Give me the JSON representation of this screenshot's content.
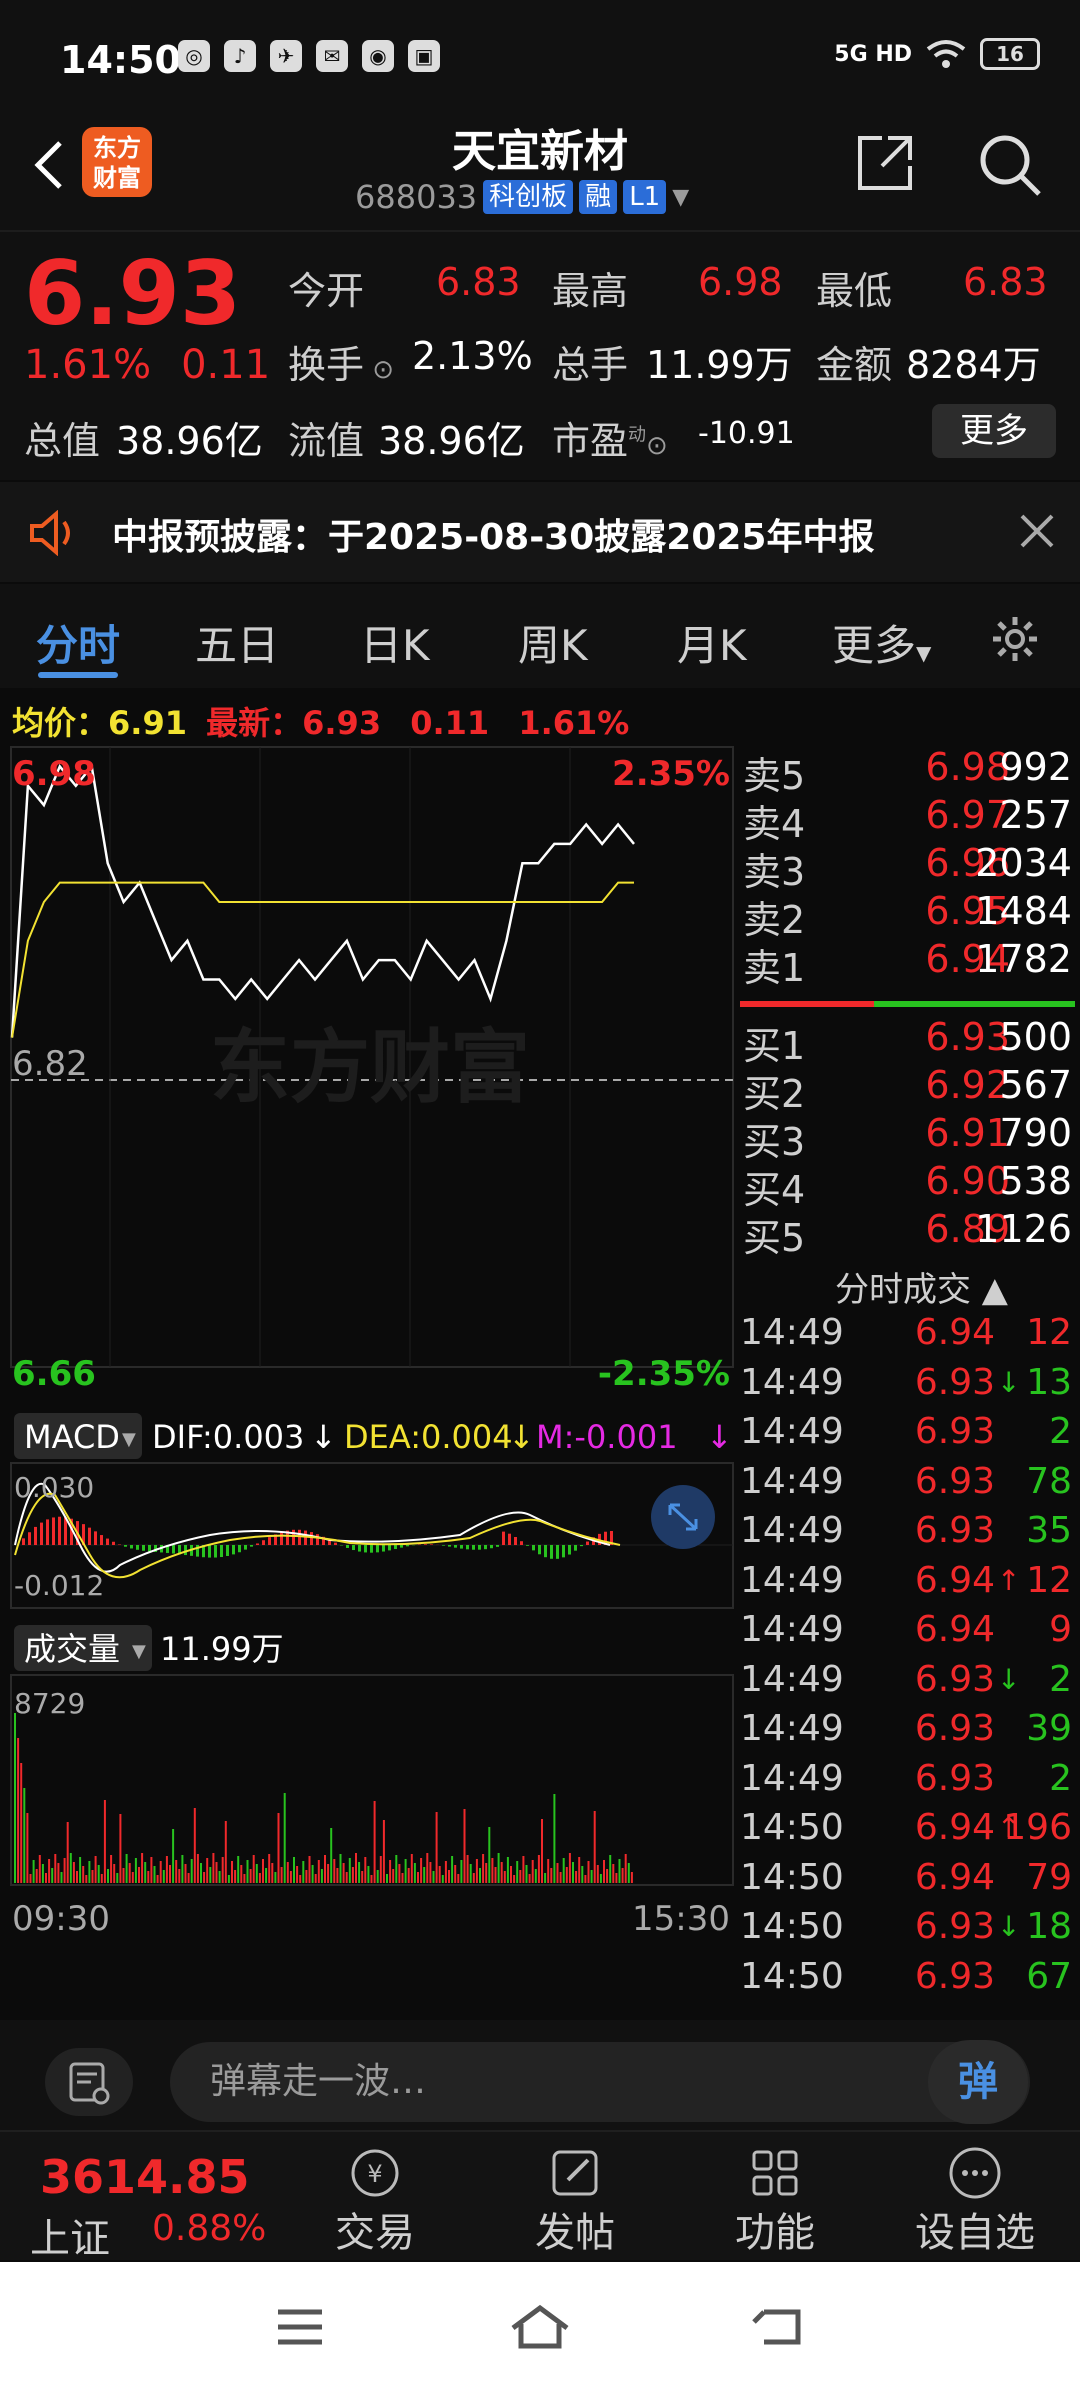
{
  "status": {
    "time": "14:50",
    "network": "5G HD",
    "battery": "16"
  },
  "header": {
    "title": "天宜新材",
    "code": "688033",
    "tags": [
      "科创板",
      "融",
      "L1"
    ],
    "logo_text": "东方\n财富"
  },
  "quote": {
    "price": "6.93",
    "change_pct": "1.61%",
    "change": "0.11",
    "open_label": "今开",
    "open": "6.83",
    "high_label": "最高",
    "high": "6.98",
    "low_label": "最低",
    "low": "6.83",
    "turnover_label": "换手",
    "turnover": "2.13%",
    "volume_label": "总手",
    "volume": "11.99万",
    "amount_label": "金额",
    "amount": "8284万",
    "mktcap_label": "总值",
    "mktcap": "38.96亿",
    "float_label": "流值",
    "float": "38.96亿",
    "pe_label": "市盈",
    "pe_sup": "动",
    "pe": "-10.91",
    "more_label": "更多"
  },
  "notice": {
    "text": "中报预披露：于2025-08-30披露2025年中报"
  },
  "tabs": {
    "items": [
      "分时",
      "五日",
      "日K",
      "周K",
      "月K",
      "更多"
    ],
    "active": 0
  },
  "avgbar": {
    "avg_label": "均价：",
    "avg": "6.91",
    "latest_label": "最新：",
    "latest": "6.93",
    "chg": "0.11",
    "pct": "1.61%"
  },
  "chart": {
    "y_top": "6.98",
    "y_top_pct": "2.35%",
    "y_mid": "6.82",
    "y_bot": "6.66",
    "y_bot_pct": "-2.35%",
    "watermark": "东方财富",
    "macd_label": "MACD",
    "dif": "DIF:0.003",
    "dea": "DEA:0.004",
    "m": "M:-0.001",
    "macd_top": "0.030",
    "macd_bot": "-0.012",
    "vol_label": "成交量",
    "vol_total": "11.99万",
    "vol_top": "8729",
    "time_start": "09:30",
    "time_end": "15:30"
  },
  "chart_data": {
    "type": "line",
    "title": "",
    "xlabel": "",
    "ylabel": "",
    "ylim": [
      6.66,
      6.98
    ],
    "x": [
      "09:30",
      "15:30"
    ],
    "series": [
      {
        "name": "",
        "values": [
          6.83,
          6.96,
          6.95,
          6.97,
          6.96,
          6.97,
          6.92,
          6.9,
          6.91,
          6.89,
          6.87,
          6.88,
          6.86,
          6.86,
          6.85,
          6.86,
          6.85,
          6.86,
          6.87,
          6.86,
          6.87,
          6.88,
          6.86,
          6.87,
          6.87,
          6.86,
          6.88,
          6.87,
          6.86,
          6.87,
          6.85,
          6.88,
          6.92,
          6.92,
          6.93,
          6.93,
          6.94,
          6.93,
          6.94,
          6.93
        ]
      },
      {
        "name": "均价",
        "values": [
          6.83,
          6.88,
          6.9,
          6.91,
          6.91,
          6.91,
          6.91,
          6.91,
          6.91,
          6.91,
          6.91,
          6.91,
          6.91,
          6.9,
          6.9,
          6.9,
          6.9,
          6.9,
          6.9,
          6.9,
          6.9,
          6.9,
          6.9,
          6.9,
          6.9,
          6.9,
          6.9,
          6.9,
          6.9,
          6.9,
          6.9,
          6.9,
          6.9,
          6.9,
          6.9,
          6.9,
          6.9,
          6.9,
          6.91,
          6.91
        ]
      }
    ]
  },
  "orderbook": {
    "sell": [
      {
        "label": "卖5",
        "price": "6.98",
        "vol": "992"
      },
      {
        "label": "卖4",
        "price": "6.97",
        "vol": "257"
      },
      {
        "label": "卖3",
        "price": "6.96",
        "vol": "2034"
      },
      {
        "label": "卖2",
        "price": "6.95",
        "vol": "1484"
      },
      {
        "label": "卖1",
        "price": "6.94",
        "vol": "1782"
      }
    ],
    "buy": [
      {
        "label": "买1",
        "price": "6.93",
        "vol": "500"
      },
      {
        "label": "买2",
        "price": "6.92",
        "vol": "567"
      },
      {
        "label": "买3",
        "price": "6.91",
        "vol": "790"
      },
      {
        "label": "买4",
        "price": "6.90",
        "vol": "538"
      },
      {
        "label": "买5",
        "price": "6.89",
        "vol": "1126"
      }
    ]
  },
  "ticks": {
    "header": "分时成交 ▲",
    "rows": [
      {
        "t": "14:49",
        "p": "6.94",
        "a": "",
        "v": "12",
        "vc": "red"
      },
      {
        "t": "14:49",
        "p": "6.93",
        "a": "↓",
        "v": "13",
        "vc": "green"
      },
      {
        "t": "14:49",
        "p": "6.93",
        "a": "",
        "v": "2",
        "vc": "green"
      },
      {
        "t": "14:49",
        "p": "6.93",
        "a": "",
        "v": "78",
        "vc": "green"
      },
      {
        "t": "14:49",
        "p": "6.93",
        "a": "",
        "v": "35",
        "vc": "green"
      },
      {
        "t": "14:49",
        "p": "6.94",
        "a": "↑",
        "v": "12",
        "vc": "red"
      },
      {
        "t": "14:49",
        "p": "6.94",
        "a": "",
        "v": "9",
        "vc": "red"
      },
      {
        "t": "14:49",
        "p": "6.93",
        "a": "↓",
        "v": "2",
        "vc": "green"
      },
      {
        "t": "14:49",
        "p": "6.93",
        "a": "",
        "v": "39",
        "vc": "green"
      },
      {
        "t": "14:49",
        "p": "6.93",
        "a": "",
        "v": "2",
        "vc": "green"
      },
      {
        "t": "14:50",
        "p": "6.94",
        "a": "↑",
        "v": "196",
        "vc": "red"
      },
      {
        "t": "14:50",
        "p": "6.94",
        "a": "",
        "v": "79",
        "vc": "red"
      },
      {
        "t": "14:50",
        "p": "6.93",
        "a": "↓",
        "v": "18",
        "vc": "green"
      },
      {
        "t": "14:50",
        "p": "6.93",
        "a": "",
        "v": "67",
        "vc": "green"
      }
    ]
  },
  "comment": {
    "placeholder": "弹幕走一波…",
    "dan": "弹"
  },
  "bottom": {
    "index_value": "3614.85",
    "index_name": "上证",
    "index_pct": "0.88%",
    "items": [
      "交易",
      "发帖",
      "功能",
      "设自选"
    ]
  }
}
